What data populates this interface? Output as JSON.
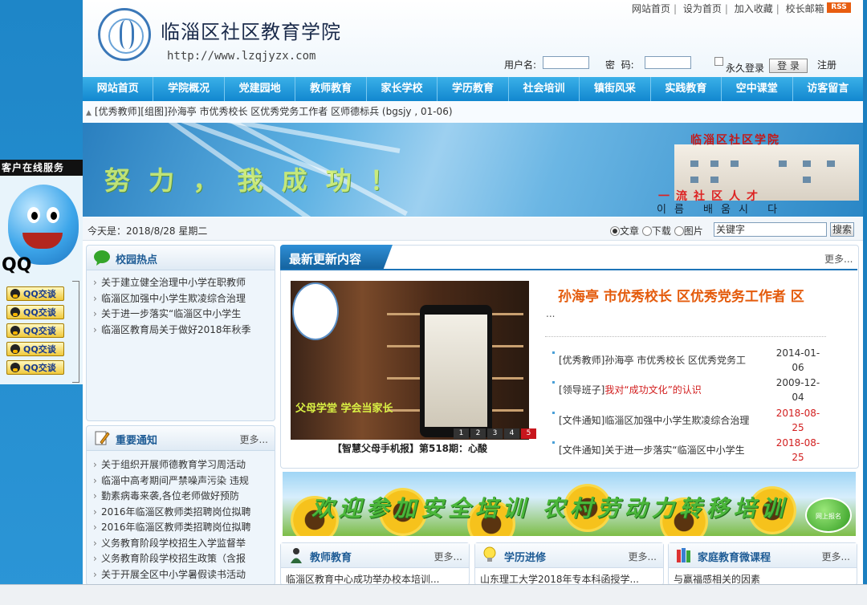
{
  "header": {
    "site_title": "临淄区社区教育学院",
    "site_url": "http://www.lzqjyzx.com",
    "top_links": [
      "网站首页",
      "设为首页",
      "加入收藏",
      "校长邮箱"
    ],
    "rss": "RSS",
    "login": {
      "username_label": "用户名:",
      "password_label": "密  码:",
      "remember_label": "永久登录",
      "login_button": "登 录",
      "register_link": "注册"
    }
  },
  "nav": [
    "网站首页",
    "学院概况",
    "党建园地",
    "教师教育",
    "家长学校",
    "学历教育",
    "社会培训",
    "镇街风采",
    "实践教育",
    "空中课堂",
    "访客留言"
  ],
  "ticker": "[优秀教师][组图]孙海亭 市优秀校长 区优秀党务工作者 区师德标兵 (bgsjy , 01-06)",
  "banner": {
    "slogan": "努 力 ， 我 成 功 ！",
    "sign": "临淄区社区学院",
    "red_text": "一流社区人才",
    "dark_text": "이름 배움시 다"
  },
  "datebar": {
    "today": "今天是：2018/8/28 星期二",
    "search_options": [
      "文章",
      "下载",
      "图片"
    ],
    "search_selected": "文章",
    "search_value": "关键字",
    "search_button": "搜索"
  },
  "left_service": {
    "title": "客户在线服务",
    "qq_badge": "QQ",
    "buttons": [
      "QQ交谈",
      "QQ交谈",
      "QQ交谈",
      "QQ交谈",
      "QQ交谈"
    ]
  },
  "campus_hot": {
    "title": "校园热点",
    "items": [
      "关于建立健全治理中小学在职教师",
      "临淄区加强中小学生欺凌综合治理",
      "关于进一步落实“临淄区中小学生",
      "临淄区教育局关于做好2018年秋季"
    ]
  },
  "notices": {
    "title": "重要通知",
    "more": "更多...",
    "items": [
      "关于组织开展师德教育学习周活动",
      "临淄中高考期间严禁噪声污染 违规",
      "勤素病毒来袭,各位老师做好预防",
      "2016年临淄区教师类招聘岗位拟聘",
      "2016年临淄区教师类招聘岗位拟聘",
      "义务教育阶段学校招生入学监督举",
      "义务教育阶段学校招生政策（含报",
      "关于开展全区中小学暑假读书活动"
    ]
  },
  "latest": {
    "title": "最新更新内容",
    "more": "更多...",
    "feature_img_text": "父母学堂   学会当家长",
    "feature_caption": "【智慧父母手机报】第518期：心酸",
    "slide_dots": [
      "1",
      "2",
      "3",
      "4",
      "5"
    ],
    "slide_active": "5",
    "headline": "孙海亭 市优秀校长 区优秀党务工作者 区",
    "headline_ellipsis": "...",
    "news": [
      {
        "prefix": "[优秀教师]",
        "text": "孙海亭 市优秀校长 区优秀党务工",
        "highlight": "",
        "date": "2014-01-06",
        "red": false
      },
      {
        "prefix": "[领导班子]",
        "text": "",
        "highlight": "我对“成功文化”的认识",
        "date": "2009-12-04",
        "red": false
      },
      {
        "prefix": "[文件通知]",
        "text": "临淄区加强中小学生欺凌综合治理",
        "highlight": "",
        "date": "2018-08-25",
        "red": true
      },
      {
        "prefix": "[文件通知]",
        "text": "关于进一步落实“临淄区中小学生",
        "highlight": "",
        "date": "2018-08-25",
        "red": true
      }
    ]
  },
  "promo": {
    "text": "欢迎参加安全培训 农村劳动力转移培训",
    "button": "网上报名"
  },
  "bottom_panels": [
    {
      "title": "教师教育",
      "more": "更多...",
      "first_item": "临淄区教育中心成功举办校本培训..."
    },
    {
      "title": "学历进修",
      "more": "更多...",
      "first_item": "山东理工大学2018年专本科函授学..."
    },
    {
      "title": "家庭教育微课程",
      "more": "更多...",
      "first_item": "与赢福感相关的因素"
    }
  ],
  "colors": {
    "nav_bg": "#1287cf",
    "accent_orange": "#e45b0c",
    "date_red": "#d21d1d",
    "panel_title": "#1d5b95"
  }
}
